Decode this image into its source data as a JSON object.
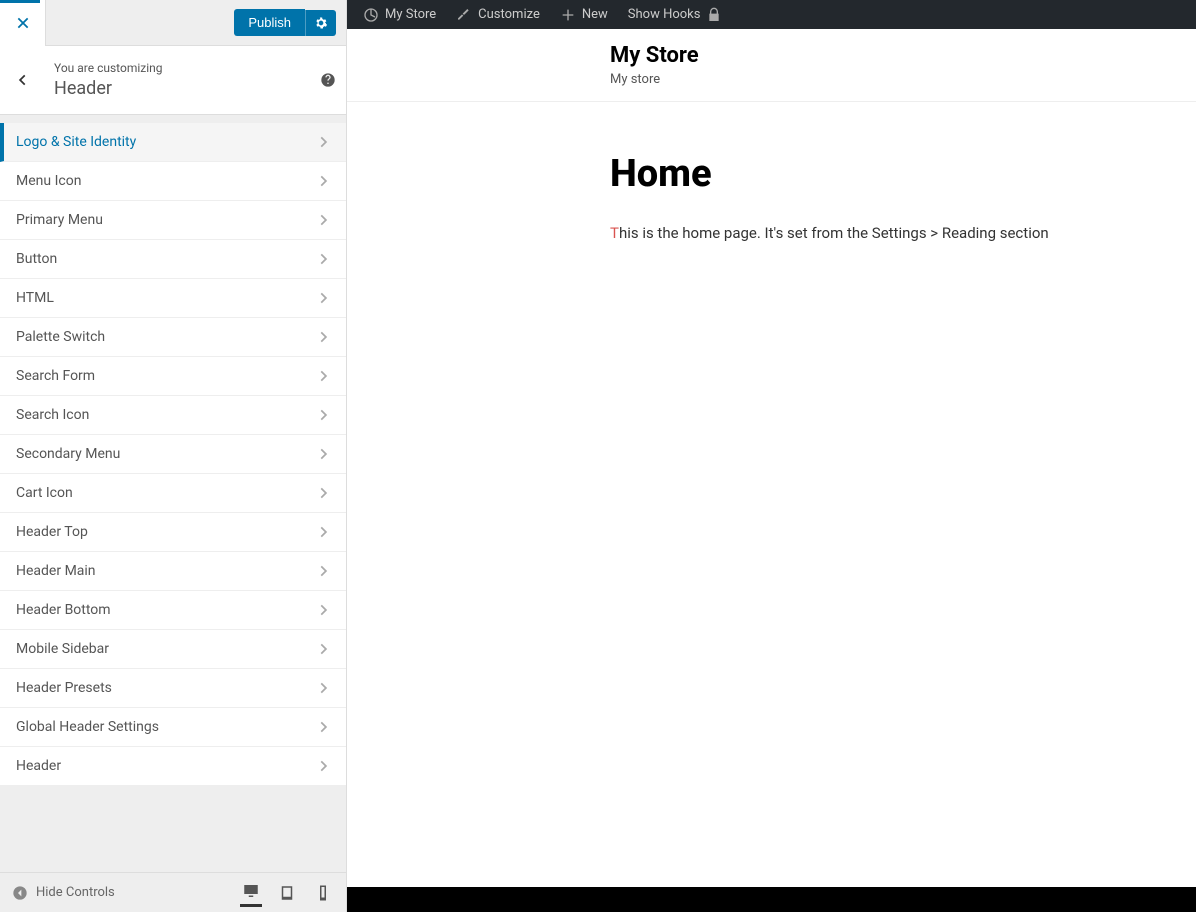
{
  "panel": {
    "publish_label": "Publish",
    "customizing_label": "You are customizing",
    "section_title": "Header",
    "hide_controls_label": "Hide Controls",
    "menu_items": [
      {
        "label": "Logo & Site Identity",
        "active": true
      },
      {
        "label": "Menu Icon",
        "active": false
      },
      {
        "label": "Primary Menu",
        "active": false
      },
      {
        "label": "Button",
        "active": false
      },
      {
        "label": "HTML",
        "active": false
      },
      {
        "label": "Palette Switch",
        "active": false
      },
      {
        "label": "Search Form",
        "active": false
      },
      {
        "label": "Search Icon",
        "active": false
      },
      {
        "label": "Secondary Menu",
        "active": false
      },
      {
        "label": "Cart Icon",
        "active": false
      },
      {
        "label": "Header Top",
        "active": false
      },
      {
        "label": "Header Main",
        "active": false
      },
      {
        "label": "Header Bottom",
        "active": false
      },
      {
        "label": "Mobile Sidebar",
        "active": false
      },
      {
        "label": "Header Presets",
        "active": false
      },
      {
        "label": "Global Header Settings",
        "active": false
      },
      {
        "label": "Header",
        "active": false
      }
    ]
  },
  "admin_bar": {
    "site_name": "My Store",
    "customize": "Customize",
    "new": "New",
    "show_hooks": "Show Hooks"
  },
  "preview": {
    "site_title": "My Store",
    "site_tagline": "My store",
    "page_title": "Home",
    "page_text": "This is the home page. It's set from the Settings > Reading section"
  }
}
